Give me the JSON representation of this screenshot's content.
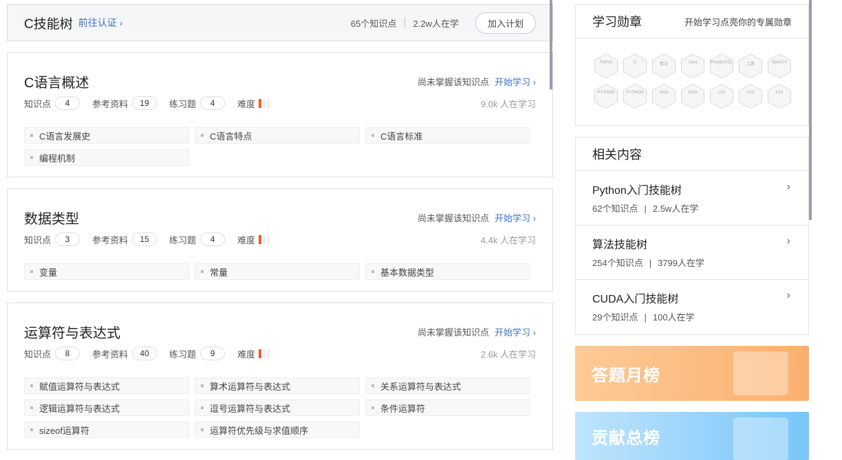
{
  "header": {
    "title": "C技能树",
    "cert_link": "前往认证 ›",
    "points": "65个知识点",
    "separator": "|",
    "learners": "2.2w人在学",
    "join_button": "加入计划"
  },
  "labels": {
    "points": "知识点",
    "refs": "参考资料",
    "exercises": "练习题",
    "difficulty": "难度",
    "not_mastered": "尚未掌握该知识点",
    "start": "开始学习 ›"
  },
  "sections": [
    {
      "title": "C语言概述",
      "points": "4",
      "refs": "19",
      "exercises": "4",
      "difficulty": 1,
      "learners": "9.0k 人在学习",
      "items": [
        "C语言发展史",
        "C语言特点",
        "C语言标准",
        "编程机制"
      ]
    },
    {
      "title": "数据类型",
      "points": "3",
      "refs": "15",
      "exercises": "4",
      "difficulty": 1,
      "learners": "4.4k 人在学习",
      "items": [
        "变量",
        "常量",
        "基本数据类型"
      ]
    },
    {
      "title": "运算符与表达式",
      "points": "8",
      "refs": "40",
      "exercises": "9",
      "difficulty": 1,
      "learners": "2.6k 人在学习",
      "items": [
        "赋值运算符与表达式",
        "算术运算符与表达式",
        "关系运算符与表达式",
        "逻辑运算符与表达式",
        "逗号运算符与表达式",
        "条件运算符",
        "sizeof运算符",
        "运算符优先级与求值顺序"
      ]
    }
  ],
  "badges": {
    "title": "学习勋章",
    "subtitle": "开始学习点亮你的专属勋章",
    "items": [
      "Python",
      "C",
      "算法",
      "Java",
      "PostgreSQL",
      "工具",
      "OpenCV",
      "PYTHON",
      "PYTHON",
      "JAVA",
      "JAVA",
      "LV3",
      "LV3",
      "LV3"
    ]
  },
  "related": {
    "title": "相关内容",
    "items": [
      {
        "name": "Python入门技能树",
        "points": "62个知识点",
        "learners": "2.5w人在学"
      },
      {
        "name": "算法技能树",
        "points": "254个知识点",
        "learners": "3799人在学"
      },
      {
        "name": "CUDA入门技能树",
        "points": "29个知识点",
        "learners": "100人在学"
      }
    ],
    "separator": "|"
  },
  "banners": {
    "monthly": "答题月榜",
    "contribution": "贡献总榜"
  },
  "colors": {
    "accent": "#3e71c7",
    "difficulty": "#f45a2d"
  }
}
